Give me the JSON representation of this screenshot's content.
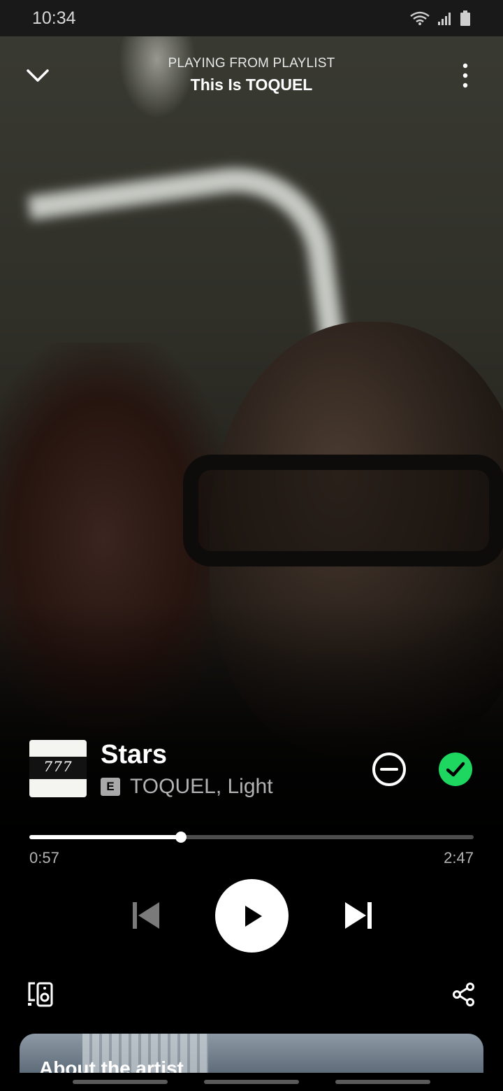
{
  "status_bar": {
    "time": "10:34"
  },
  "header": {
    "context_label": "PLAYING FROM PLAYLIST",
    "context_name": "This Is TOQUEL"
  },
  "track": {
    "cover_text": "777",
    "title": "Stars",
    "explicit_badge": "E",
    "artists": "TOQUEL, Light",
    "liked": true
  },
  "progress": {
    "elapsed": "0:57",
    "duration": "2:47",
    "fraction": 0.341
  },
  "controls": {
    "state": "paused"
  },
  "about_card": {
    "title": "About the artist"
  },
  "colors": {
    "accent": "#1ed760",
    "text_secondary": "#b3b3b3",
    "progress_track": "#4d4d4d"
  }
}
